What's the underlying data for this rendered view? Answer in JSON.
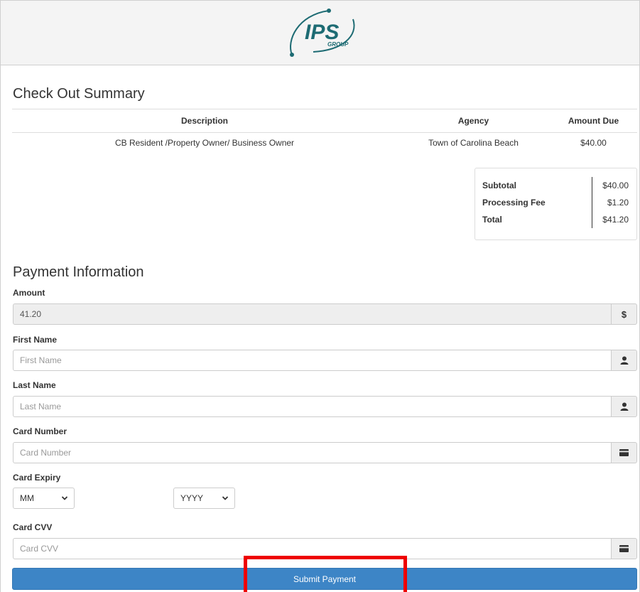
{
  "header": {
    "logo_text": "IPS",
    "logo_subtext": "GROUP",
    "logo_color": "#1d6b73"
  },
  "summary": {
    "title": "Check Out Summary",
    "columns": [
      "Description",
      "Agency",
      "Amount Due"
    ],
    "rows": [
      [
        "CB Resident /Property Owner/ Business Owner",
        "Town of Carolina Beach",
        "$40.00"
      ]
    ],
    "totals": [
      {
        "label": "Subtotal",
        "value": "$40.00"
      },
      {
        "label": "Processing Fee",
        "value": "$1.20"
      },
      {
        "label": "Total",
        "value": "$41.20"
      }
    ]
  },
  "payment": {
    "title": "Payment Information",
    "amount": {
      "label": "Amount",
      "value": "41.20",
      "addon": "$"
    },
    "first_name": {
      "label": "First Name",
      "placeholder": "First Name",
      "icon": "user-icon"
    },
    "last_name": {
      "label": "Last Name",
      "placeholder": "Last Name",
      "icon": "user-icon"
    },
    "card_number": {
      "label": "Card Number",
      "placeholder": "Card Number",
      "icon": "credit-card-icon"
    },
    "card_expiry": {
      "label": "Card Expiry",
      "month_selected": "MM",
      "year_selected": "YYYY"
    },
    "card_cvv": {
      "label": "Card CVV",
      "placeholder": "Card CVV",
      "icon": "credit-card-icon"
    },
    "submit_label": "Submit Payment"
  },
  "colors": {
    "submit_button": "#3d85c6",
    "highlight_box": "#ee0000"
  }
}
